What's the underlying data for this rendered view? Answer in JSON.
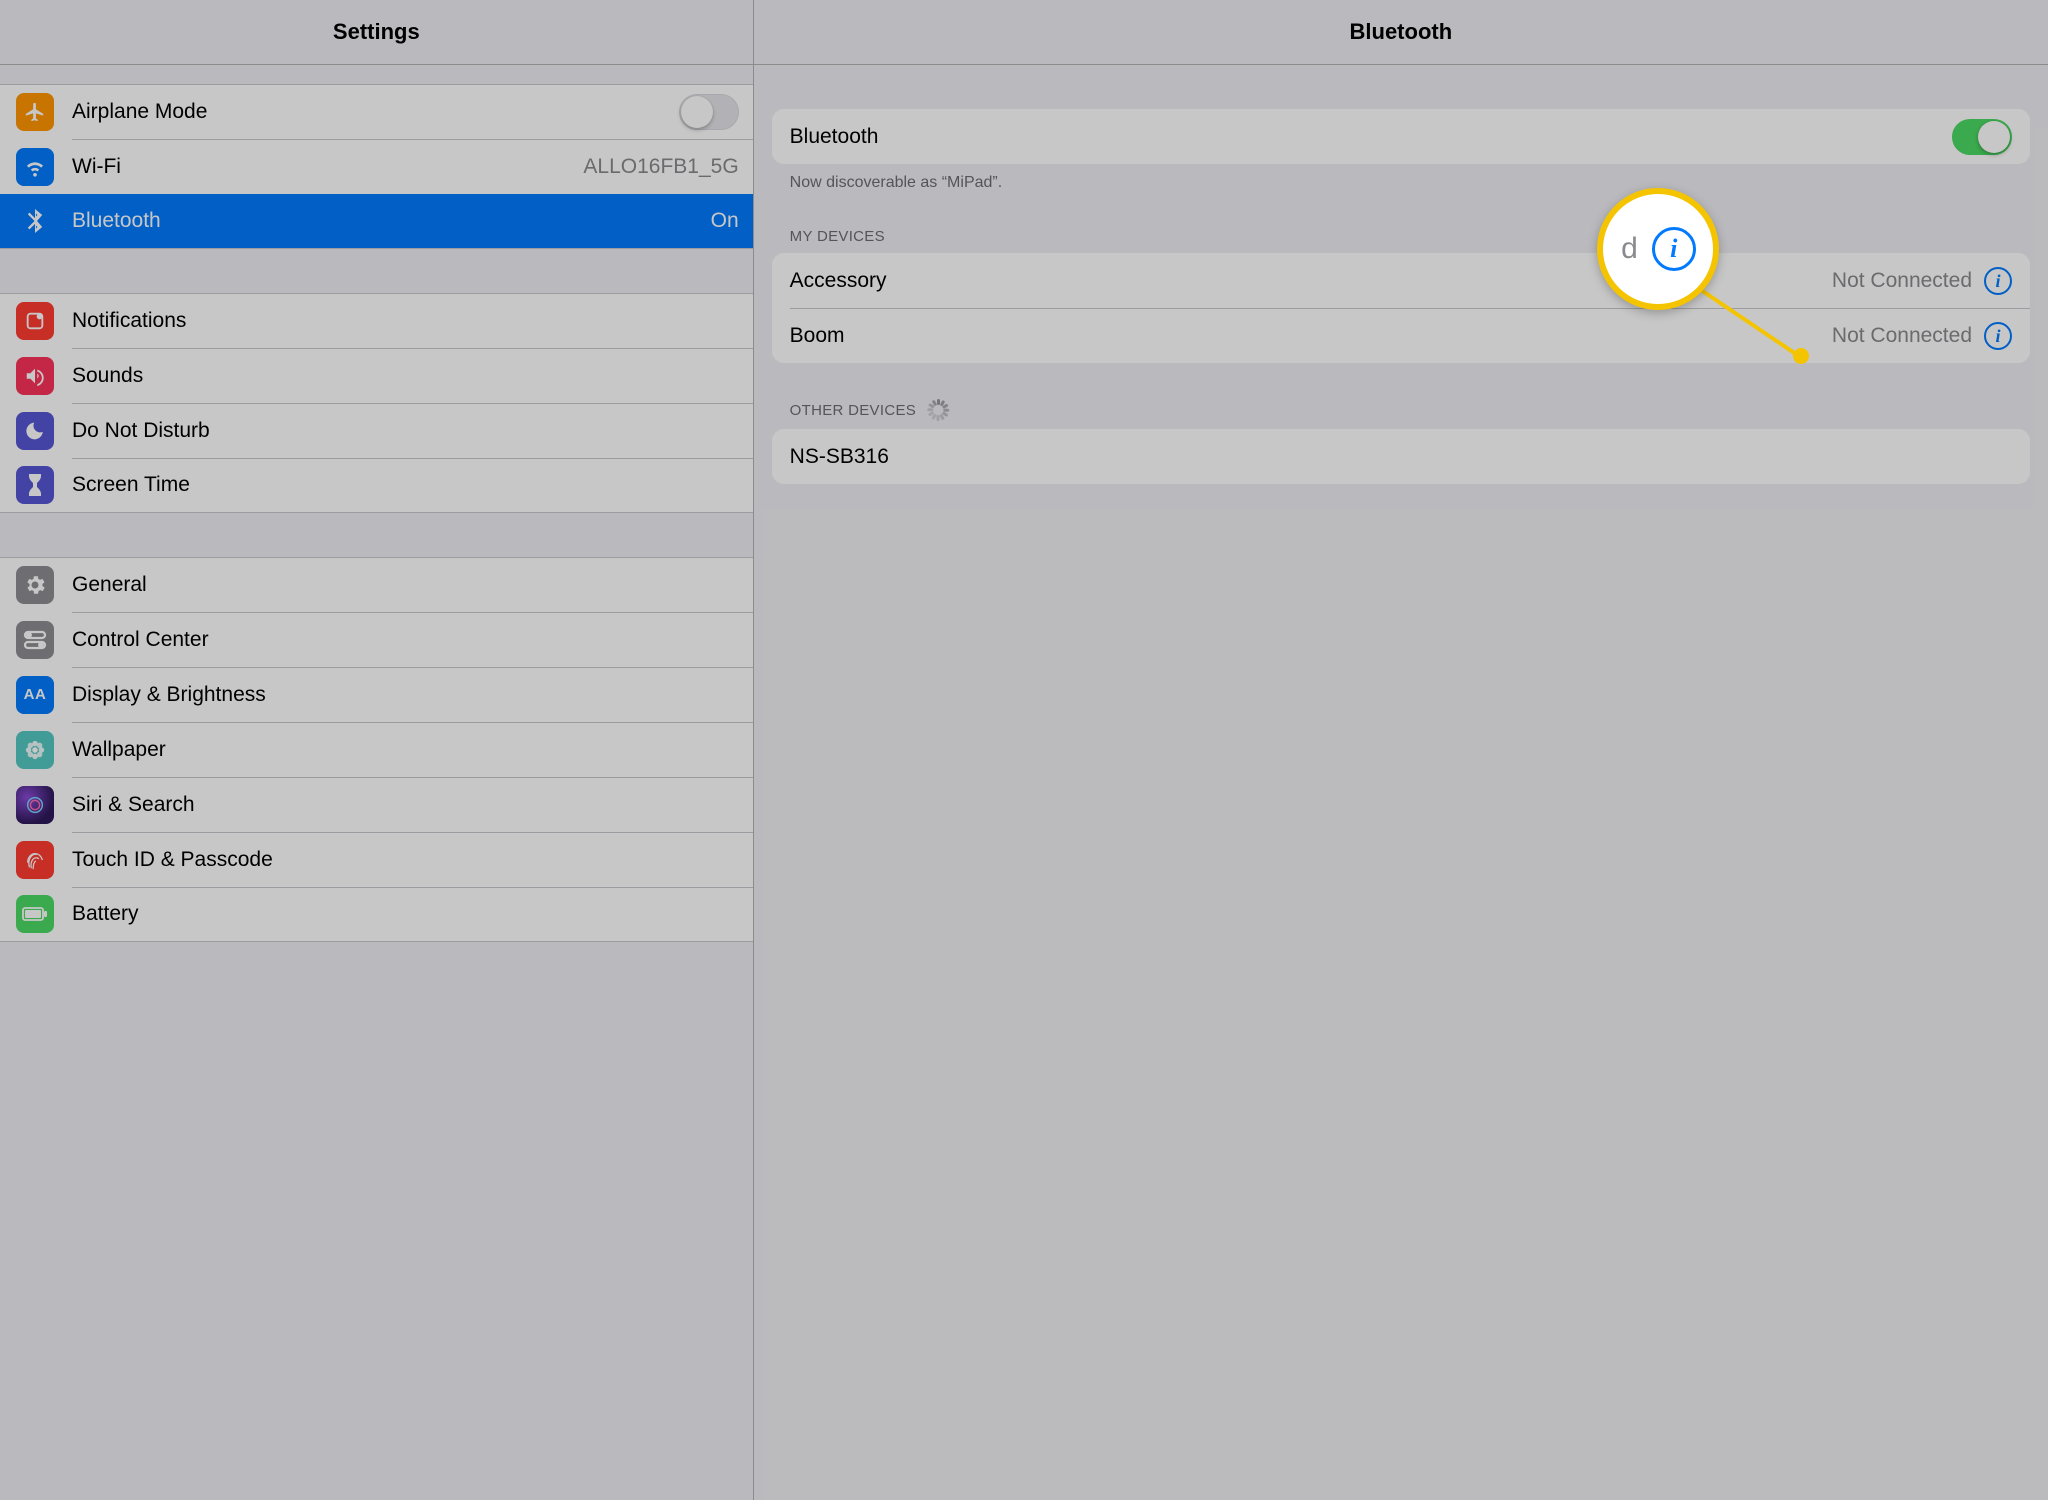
{
  "sidebar": {
    "title": "Settings",
    "rows": {
      "airplane": {
        "label": "Airplane Mode"
      },
      "wifi": {
        "label": "Wi-Fi",
        "value": "ALLO16FB1_5G"
      },
      "bluetooth": {
        "label": "Bluetooth",
        "value": "On"
      },
      "notifications": {
        "label": "Notifications"
      },
      "sounds": {
        "label": "Sounds"
      },
      "dnd": {
        "label": "Do Not Disturb"
      },
      "screentime": {
        "label": "Screen Time"
      },
      "general": {
        "label": "General"
      },
      "controlcenter": {
        "label": "Control Center"
      },
      "display": {
        "label": "Display & Brightness"
      },
      "wallpaper": {
        "label": "Wallpaper"
      },
      "siri": {
        "label": "Siri & Search"
      },
      "touchid": {
        "label": "Touch ID & Passcode"
      },
      "battery": {
        "label": "Battery"
      }
    }
  },
  "detail": {
    "title": "Bluetooth",
    "toggle_label": "Bluetooth",
    "discoverable_text": "Now discoverable as “MiPad”.",
    "my_devices_header": "MY DEVICES",
    "my_devices": [
      {
        "name": "Accessory",
        "status": "Not Connected"
      },
      {
        "name": "Boom",
        "status": "Not Connected"
      }
    ],
    "other_devices_header": "OTHER DEVICES",
    "other_devices": [
      {
        "name": "NS-SB316"
      }
    ]
  },
  "callout": {
    "fragment": "d"
  }
}
